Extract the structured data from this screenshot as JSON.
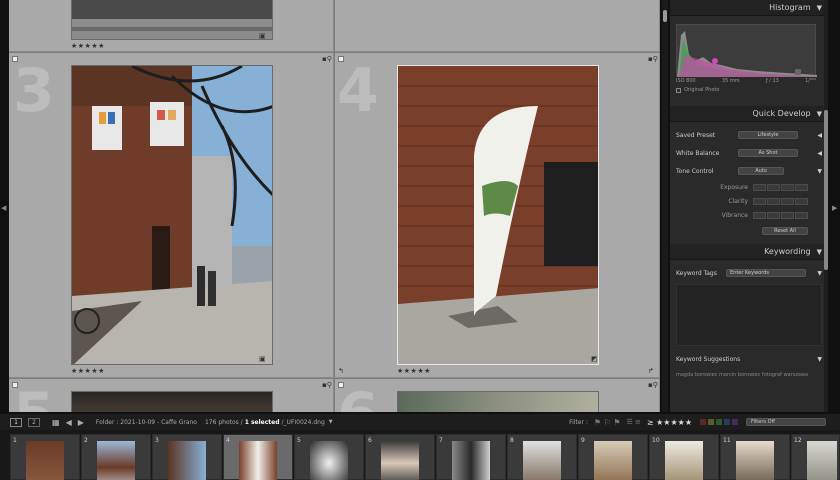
{
  "grid": {
    "cells": [
      {
        "number": "3",
        "stars": "★★★★★"
      },
      {
        "number": "4",
        "stars": "★★★★★"
      },
      {
        "number": "5"
      },
      {
        "number": "6"
      }
    ],
    "top_stars": "★★★★★"
  },
  "panel": {
    "histogram": {
      "title": "Histogram",
      "iso": "ISO 800",
      "focal": "35 mm",
      "aperture": "ƒ / 13",
      "shutter": "1/⁵⁰⁰",
      "original_photo_label": "Original Photo"
    },
    "quick_develop": {
      "title": "Quick Develop",
      "saved_preset_label": "Saved Preset",
      "saved_preset_value": "Lifestyle",
      "white_balance_label": "White Balance",
      "white_balance_value": "As Shot",
      "tone_control_label": "Tone Control",
      "auto_label": "Auto",
      "exposure_label": "Exposure",
      "clarity_label": "Clarity",
      "vibrance_label": "Vibrance",
      "reset_label": "Reset All"
    },
    "keywording": {
      "title": "Keywording",
      "keyword_tags_label": "Keyword Tags",
      "keyword_tags_value": "Enter Keywords",
      "suggestions_label": "Keyword Suggestions",
      "suggestions_text": "magda borowiec  marcin borowiec  fotograf warszawa"
    }
  },
  "filmstrip_bar": {
    "view1": "1",
    "view2": "2",
    "folder": "Folder : 2021-10-09 - Caffe Grano",
    "count_prefix": "176 photos /",
    "selected": "1 selected",
    "filename": "/_UFI0024.dng",
    "filter_label": "Filter :",
    "filters_off": "Filters Off"
  },
  "filmstrip": {
    "numbers": [
      "1",
      "2",
      "3",
      "4",
      "5",
      "6",
      "7",
      "8",
      "9",
      "10",
      "11",
      "12"
    ]
  },
  "colors": {
    "panel_bg": "#2a2a2a",
    "grid_bg": "#a9a9a9",
    "filmstrip_bg": "#181818"
  }
}
